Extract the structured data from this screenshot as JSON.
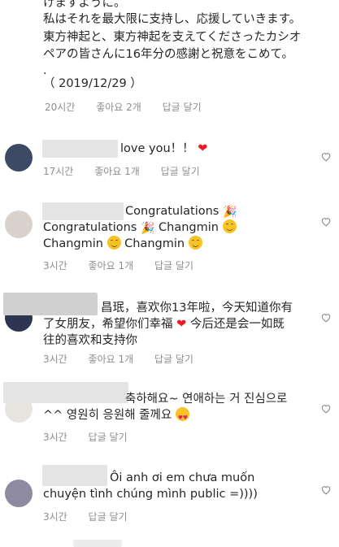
{
  "thread_tail": {
    "line0": "けますように。",
    "line1": "私はそれを最大限に支持し、応援していきます。",
    "line2": "東方神起と、東方神起を支えてくださったカシオ",
    "line3": "ペアの皆さんに16年分の感謝と祝意をこめて。",
    "line4": ".",
    "line5": "（ 2019/12/29 ）",
    "time": "20시간",
    "likes": "좋아요 2개",
    "reply": "답글 달기"
  },
  "comments": [
    {
      "text": "love you！！",
      "time": "17시간",
      "likes": "좋아요 1개",
      "reply": "답글 달기"
    },
    {
      "line1": "Congratulations",
      "line2a": "Congratulations",
      "line2b": "Changmin",
      "line3a": "Changmin",
      "line3b": "Changmin",
      "time": "3시간",
      "likes": "좋아요 1개",
      "reply": "답글 달기"
    },
    {
      "line1": "昌珉，喜欢你13年啦，今天知道你有",
      "line2a": "了女朋友，希望你们幸福",
      "line2b": "今后还是会一如既",
      "line3": "往的喜欢和支持你",
      "time": "3시간",
      "likes": "좋아요 1개",
      "reply": "답글 달기"
    },
    {
      "line1": "축하해요~ 연애하는 거 진심으로",
      "line2": "^^ 영원히 응원해 줄께요",
      "time": "3시간",
      "reply": "답글 달기"
    },
    {
      "line1": "Ôi anh ơi em chưa muốn",
      "line2": "chuyện tình chúng mình public =))))",
      "time": "3시간",
      "reply": "답글 달기"
    }
  ],
  "icons": {
    "like": "heart-outline-icon",
    "emoji_heart": "red-heart-emoji",
    "emoji_party": "party-popper-emoji",
    "emoji_smile": "smiling-face-emoji",
    "emoji_kiss": "heart-eyes-emoji"
  },
  "colors": {
    "text": "#262626",
    "meta": "#8e8e8e",
    "heart_emoji": "#ed1c24",
    "background": "#ffffff"
  }
}
